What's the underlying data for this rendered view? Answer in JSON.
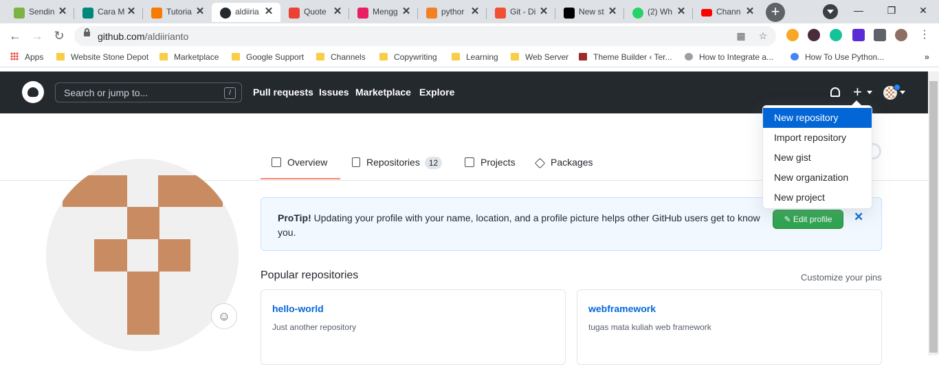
{
  "browser": {
    "tabs": [
      {
        "title": "Sendin",
        "favicon_color": "#7cb342"
      },
      {
        "title": "Cara M",
        "favicon_color": "#00897b"
      },
      {
        "title": "Tutoria",
        "favicon_color": "#f57c00"
      },
      {
        "title": "aldiiria",
        "favicon_color": "#24292e"
      },
      {
        "title": "Quote",
        "favicon_color": "#ea4335"
      },
      {
        "title": "Mengg",
        "favicon_color": "#e91e63"
      },
      {
        "title": "pythor",
        "favicon_color": "#f48024"
      },
      {
        "title": "Git - Di",
        "favicon_color": "#f05133"
      },
      {
        "title": "New st",
        "favicon_color": "#000000"
      },
      {
        "title": "(2) Wh",
        "favicon_color": "#25d366"
      },
      {
        "title": "Chann",
        "favicon_color": "#ff0000"
      }
    ],
    "close_glyph": "✕",
    "new_tab_glyph": "+",
    "window_controls": {
      "minimize": "—",
      "restore": "❐",
      "close": "✕"
    },
    "url_host": "github.com",
    "url_path": "/aldiirianto",
    "bookmarks": [
      {
        "label": "Apps",
        "icon": "apps-grid-icon"
      },
      {
        "label": "Website Stone Depot",
        "icon": "folder-icon"
      },
      {
        "label": "Marketplace",
        "icon": "folder-icon"
      },
      {
        "label": "Google Support",
        "icon": "folder-icon"
      },
      {
        "label": "Channels",
        "icon": "folder-icon"
      },
      {
        "label": "Copywriting",
        "icon": "folder-icon"
      },
      {
        "label": "Learning",
        "icon": "folder-icon"
      },
      {
        "label": "Web Server",
        "icon": "folder-icon"
      },
      {
        "label": "Theme Builder ‹ Ter...",
        "icon": "site-icon"
      },
      {
        "label": "How to Integrate a...",
        "icon": "site-icon"
      },
      {
        "label": "How To Use Python...",
        "icon": "site-icon"
      }
    ],
    "bookmarks_more": "»"
  },
  "github": {
    "search_placeholder": "Search or jump to...",
    "search_shortcut": "/",
    "nav": [
      "Pull requests",
      "Issues",
      "Marketplace",
      "Explore"
    ],
    "plus_glyph": "+",
    "profile_tabs": [
      {
        "label": "Overview",
        "count": ""
      },
      {
        "label": "Repositories",
        "count": "12"
      },
      {
        "label": "Projects",
        "count": ""
      },
      {
        "label": "Packages",
        "count": ""
      }
    ],
    "protip": {
      "lead": "ProTip!",
      "text": " Updating your profile with your name, location, and a profile picture helps other GitHub users get to know you.",
      "button": "✎ Edit profile",
      "dismiss": "✕"
    },
    "popular_title": "Popular repositories",
    "customize_label": "Customize your pins",
    "repos": [
      {
        "name": "hello-world",
        "description": "Just another repository"
      },
      {
        "name": "webframework",
        "description": "tugas mata kuliah web framework"
      }
    ],
    "emoji_glyph": "☺",
    "create_menu": [
      {
        "label": "New repository",
        "highlighted": true
      },
      {
        "label": "Import repository",
        "highlighted": false
      },
      {
        "label": "New gist",
        "highlighted": false
      },
      {
        "label": "New organization",
        "highlighted": false
      },
      {
        "label": "New project",
        "highlighted": false
      }
    ],
    "colors": {
      "header_bg": "#24292e",
      "accent": "#0366d6",
      "protip_bg": "#f1f8ff",
      "button_green": "#2ea44f",
      "avatar_tile": "#c98c62"
    }
  }
}
